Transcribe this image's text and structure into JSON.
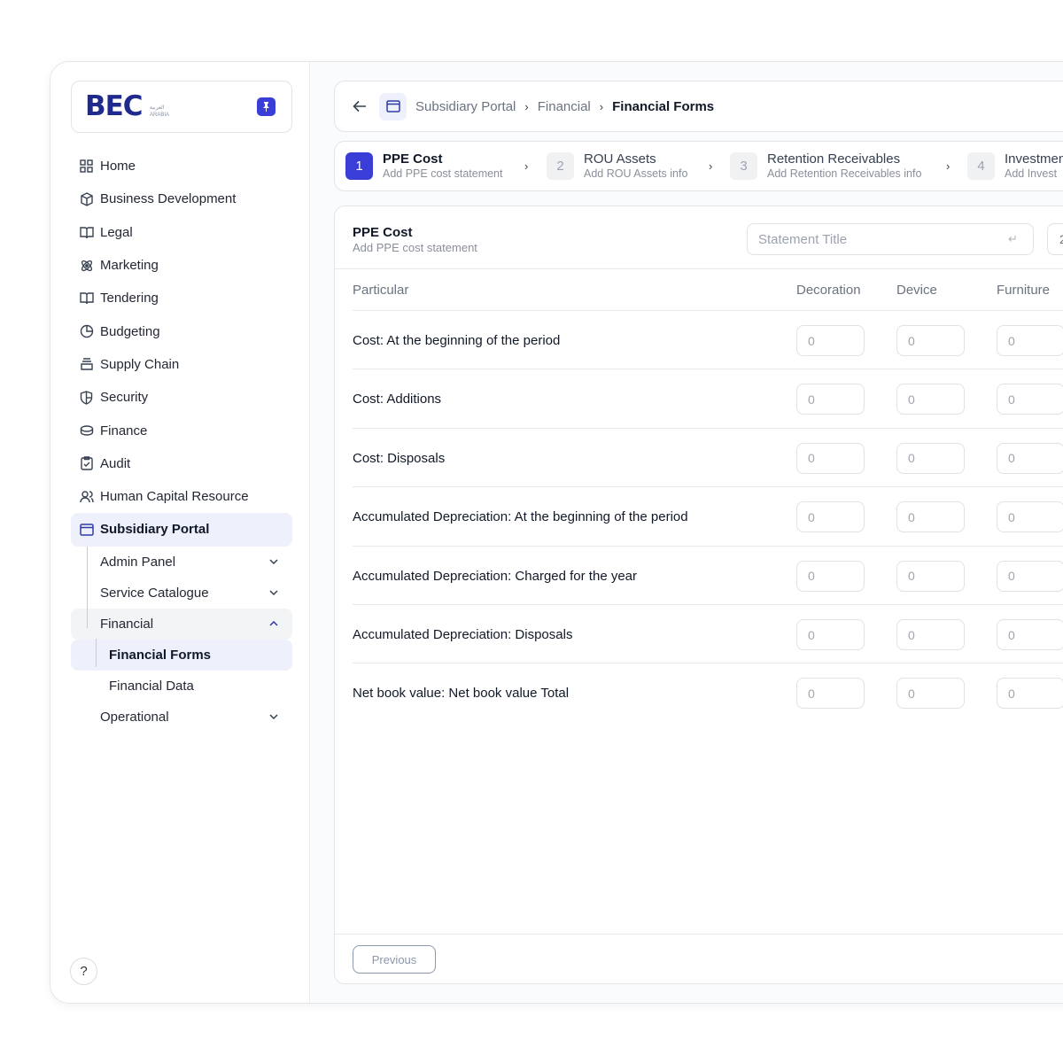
{
  "brand": {
    "logo_text": "BEC",
    "logo_arabic": "العربية",
    "logo_sub": "ARABIA"
  },
  "sidebar": {
    "items": [
      {
        "label": "Home",
        "icon": "grid-icon"
      },
      {
        "label": "Business Development",
        "icon": "box-icon"
      },
      {
        "label": "Legal",
        "icon": "book-icon"
      },
      {
        "label": "Marketing",
        "icon": "atom-icon"
      },
      {
        "label": "Tendering",
        "icon": "book-icon"
      },
      {
        "label": "Budgeting",
        "icon": "pie-icon"
      },
      {
        "label": "Supply Chain",
        "icon": "stack-icon"
      },
      {
        "label": "Security",
        "icon": "shield-icon"
      },
      {
        "label": "Finance",
        "icon": "coins-icon"
      },
      {
        "label": "Audit",
        "icon": "clipboard-check-icon"
      },
      {
        "label": "Human Capital Resource",
        "icon": "users-icon"
      },
      {
        "label": "Subsidiary Portal",
        "icon": "window-icon",
        "active": true
      }
    ],
    "subitems": {
      "admin_panel": "Admin Panel",
      "service_catalogue": "Service Catalogue",
      "financial": "Financial",
      "financial_forms": "Financial Forms",
      "financial_data": "Financial Data",
      "operational": "Operational"
    },
    "help": "?"
  },
  "breadcrumb": {
    "items": [
      "Subsidiary Portal",
      "Financial",
      "Financial Forms"
    ]
  },
  "steps": [
    {
      "num": "1",
      "title": "PPE Cost",
      "sub": "Add PPE cost statement"
    },
    {
      "num": "2",
      "title": "ROU Assets",
      "sub": "Add ROU Assets info"
    },
    {
      "num": "3",
      "title": "Retention Receivables",
      "sub": "Add Retention Receivables info"
    },
    {
      "num": "4",
      "title": "Investmen",
      "sub": "Add Invest"
    }
  ],
  "form": {
    "title": "PPE Cost",
    "subtitle": "Add PPE cost statement",
    "statement_placeholder": "Statement Title",
    "head_right_text": "2",
    "columns": [
      "Particular",
      "Decoration",
      "Device",
      "Furniture"
    ],
    "cell_placeholder": "0",
    "rows": [
      "Cost: At the beginning of the period",
      "Cost: Additions",
      "Cost: Disposals",
      "Accumulated Depreciation: At the beginning of the period",
      "Accumulated Depreciation: Charged for the year",
      "Accumulated Depreciation: Disposals",
      "Net book value: Net book value Total"
    ],
    "previous_label": "Previous"
  },
  "colors": {
    "accent": "#3b3ed6",
    "brand": "#1f2a8c",
    "active_bg": "#eef1fb"
  }
}
